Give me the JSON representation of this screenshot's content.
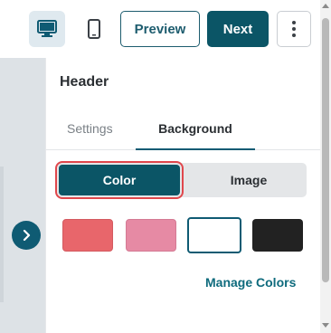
{
  "toolbar": {
    "desktop_icon": "desktop-icon",
    "mobile_icon": "mobile-icon",
    "preview_label": "Preview",
    "next_label": "Next",
    "more_icon": "more-vertical-icon"
  },
  "panel": {
    "title": "Header",
    "tabs": [
      {
        "label": "Settings",
        "active": false
      },
      {
        "label": "Background",
        "active": true
      }
    ],
    "fill_type": {
      "options": [
        "Color",
        "Image"
      ],
      "selected": "Color"
    },
    "swatches": [
      {
        "color": "#e8666b",
        "selected": false
      },
      {
        "color": "#e68aa4",
        "selected": false
      },
      {
        "color": "#ffffff",
        "selected": true
      },
      {
        "color": "#222222",
        "selected": false
      }
    ],
    "manage_colors_label": "Manage Colors"
  },
  "colors": {
    "brand": "#0b5566",
    "accent": "#0f6b7d",
    "highlight_outline": "#e0474c"
  }
}
